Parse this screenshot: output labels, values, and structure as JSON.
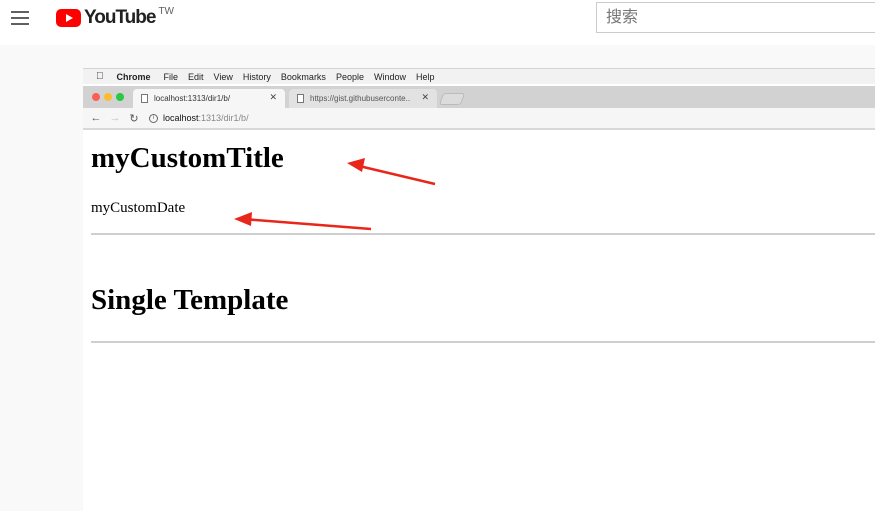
{
  "youtube": {
    "logo_text": "YouTube",
    "region": "TW",
    "search_placeholder": "搜索"
  },
  "menubar": {
    "app": "Chrome",
    "items": [
      "File",
      "Edit",
      "View",
      "History",
      "Bookmarks",
      "People",
      "Window",
      "Help"
    ]
  },
  "tabs": [
    {
      "title": "localhost:1313/dir1/b/",
      "active": true
    },
    {
      "title": "https://gist.githubuserconte..",
      "active": false
    }
  ],
  "address": {
    "host": "localhost",
    "path": ":1313/dir1/b/"
  },
  "page": {
    "title": "myCustomTitle",
    "date": "myCustomDate",
    "section_heading": "Single Template"
  },
  "colors": {
    "youtube_red": "#ff0000",
    "annotation_arrow": "#e8261a"
  }
}
